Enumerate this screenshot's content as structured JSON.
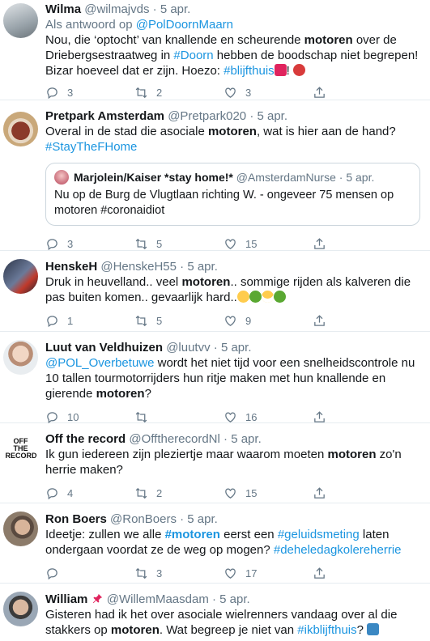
{
  "tweets": [
    {
      "name": "Wilma",
      "handle": "@wilmajvds",
      "date": "5 apr.",
      "reply_prefix": "Als antwoord op ",
      "reply_to": "@PolDoornMaarn",
      "text": {
        "p1": "Nou, die ‘optocht’ van knallende en scheurende ",
        "b1": "motoren",
        "p2": " over de Driebergsestraatweg in ",
        "l1": "#Doorn",
        "p3": " hebben de boodschap niet begrepen! Bizar hoeveel dat er zijn. Hoezo: ",
        "l2": "#blijfthuis",
        "p4": "! "
      },
      "replies": "3",
      "retweets": "2",
      "likes": "3"
    },
    {
      "name": "Pretpark Amsterdam",
      "handle": "@Pretpark020",
      "date": "5 apr.",
      "text": {
        "p1": "Overal in de stad die asociale ",
        "b1": "motoren",
        "p2": ", wat is hier aan de hand? ",
        "l1": "#StayTheFHome"
      },
      "quote": {
        "name": "Marjolein/Kaiser *stay home!*",
        "handle": "@AmsterdamNurse",
        "date": "5 apr.",
        "text": "Nu op de Burg de Vlugtlaan richting W. - ongeveer 75 mensen op motoren #coronaidiot"
      },
      "replies": "3",
      "retweets": "5",
      "likes": "15"
    },
    {
      "name": "HenskeH",
      "handle": "@HenskeH55",
      "date": "5 apr.",
      "text": {
        "p1": "Druk in heuvelland.. veel ",
        "b1": "motoren",
        "p2": "..  sommige rijden als kalveren die pas buiten komen.. gevaarlijk hard.."
      },
      "replies": "1",
      "retweets": "5",
      "likes": "9"
    },
    {
      "name": "Luut van Veldhuizen",
      "handle": "@luutvv",
      "date": "5 apr.",
      "text": {
        "l1": "@POL_Overbetuwe",
        "p1": " wordt het niet tijd voor een snelheidscontrole nu 10 tallen tourmotorrijders hun ritje maken met hun knallende en gierende ",
        "b1": "motoren",
        "p2": "?"
      },
      "replies": "10",
      "retweets": "",
      "likes": "16"
    },
    {
      "name": "Off the record",
      "handle": "@OfftherecordNl",
      "date": "5 apr.",
      "avatar_text": "OFF THE RECORD",
      "text": {
        "p1": "Ik gun iedereen zijn pleziertje maar waarom moeten ",
        "b1": "motoren",
        "p2": " zo'n herrie maken?"
      },
      "replies": "4",
      "retweets": "2",
      "likes": "15"
    },
    {
      "name": "Ron Boers",
      "handle": "@RonBoers",
      "date": "5 apr.",
      "text": {
        "p1": "Ideetje: zullen we alle ",
        "l1": "#motoren",
        "p2": " eerst een ",
        "l2": "#geluidsmeting",
        "p3": " laten ondergaan voordat ze de weg op mogen? ",
        "l3": "#deheledagkolereherrie"
      },
      "replies": "",
      "retweets": "3",
      "likes": "17"
    },
    {
      "name": "William",
      "handle": "@WillemMaasdam",
      "date": "5 apr.",
      "text": {
        "p1": "Gisteren had ik het over asociale wielrenners vandaag over al die stakkers op ",
        "b1": "motoren",
        "p2": ". Wat begreep je niet van ",
        "l1": "#ikblijfthuis",
        "p3": "? "
      },
      "replies": "",
      "retweets": "",
      "likes": ""
    }
  ],
  "icons": [
    "reply-icon",
    "retweet-icon",
    "like-icon",
    "share-icon",
    "pin-icon",
    "house-emoji",
    "angry-emoji",
    "scream-emoji",
    "clover-emoji",
    "mask-emoji",
    "accessible-emoji"
  ],
  "colors": {
    "link": "#1b95e0",
    "muted": "#657786",
    "border": "#e6ecf0"
  }
}
